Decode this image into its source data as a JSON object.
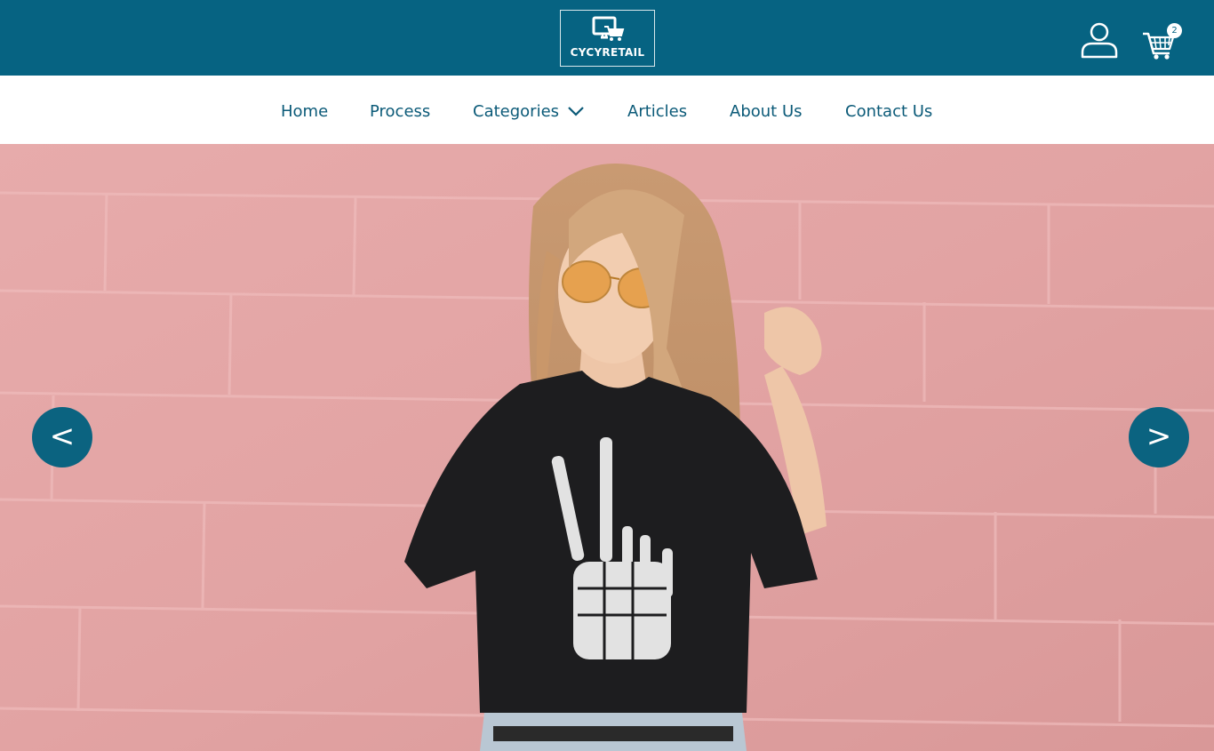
{
  "brand": {
    "logo_text": "CYCYRETAIL"
  },
  "header": {
    "cart_count": "2"
  },
  "nav": {
    "items": [
      {
        "label": "Home"
      },
      {
        "label": "Process"
      },
      {
        "label": "Categories"
      },
      {
        "label": "Articles"
      },
      {
        "label": "About Us"
      },
      {
        "label": "Contact Us"
      }
    ]
  },
  "hero": {
    "prev_label": "<",
    "next_label": ">"
  },
  "colors": {
    "primary": "#066382",
    "nav_text": "#0b5a78",
    "hero_background": "#e3a4a4",
    "arrow_background": "#0b6380"
  },
  "icons": {
    "logo": "monitor-cart-icon",
    "user": "user-icon",
    "cart": "shopping-cart-icon",
    "dropdown": "chevron-down-icon"
  }
}
